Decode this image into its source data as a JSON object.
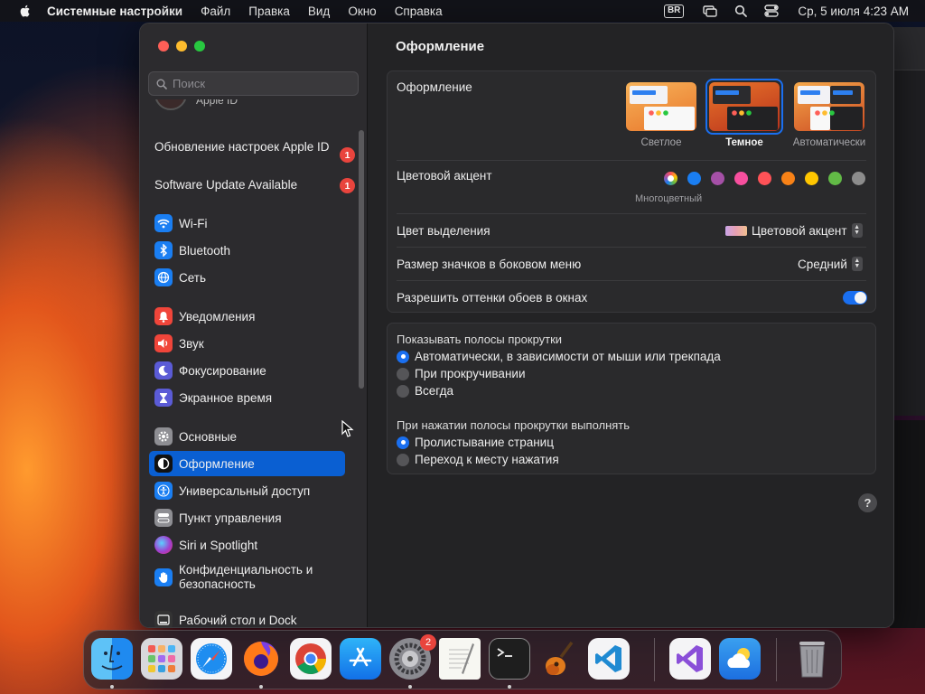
{
  "menubar": {
    "app_name": "Системные настройки",
    "items": [
      "Файл",
      "Правка",
      "Вид",
      "Окно",
      "Справка"
    ],
    "keyboard_badge": "BR",
    "clock": "Ср, 5 июля  4:23 AM"
  },
  "sidebar": {
    "search_placeholder": "Поиск",
    "apple_id_label": "Apple ID",
    "notices": [
      {
        "label": "Обновление настроек Apple ID",
        "badge": "1"
      },
      {
        "label": "Software Update Available",
        "badge": "1"
      }
    ],
    "items": [
      {
        "label": "Wi-Fi",
        "icon": "wifi-icon",
        "color": "#1a7ef2"
      },
      {
        "label": "Bluetooth",
        "icon": "bluetooth-icon",
        "color": "#1a7ef2"
      },
      {
        "label": "Сеть",
        "icon": "globe-icon",
        "color": "#1a7ef2"
      },
      {
        "label": "Уведомления",
        "icon": "bell-icon",
        "color": "#f0453a"
      },
      {
        "label": "Звук",
        "icon": "speaker-icon",
        "color": "#f0453a"
      },
      {
        "label": "Фокусирование",
        "icon": "moon-icon",
        "color": "#5b5bd6"
      },
      {
        "label": "Экранное время",
        "icon": "hourglass-icon",
        "color": "#5b5bd6"
      },
      {
        "label": "Основные",
        "icon": "gear-icon",
        "color": "#8e8e93"
      },
      {
        "label": "Оформление",
        "icon": "appearance-icon",
        "color": "#111111"
      },
      {
        "label": "Универсальный доступ",
        "icon": "accessibility-icon",
        "color": "#1a7ef2"
      },
      {
        "label": "Пункт управления",
        "icon": "control-center-icon",
        "color": "#8e8e93"
      },
      {
        "label": "Siri и Spotlight",
        "icon": "siri-icon",
        "color": "#a040d0"
      },
      {
        "label": "Конфиденциальность и безопасность",
        "icon": "hand-icon",
        "color": "#1a7ef2"
      },
      {
        "label": "Рабочий стол и Dock",
        "icon": "desktop-dock-icon",
        "color": "#333333"
      }
    ]
  },
  "content": {
    "title": "Оформление",
    "appearance": {
      "label": "Оформление",
      "options": [
        "Светлое",
        "Темное",
        "Автоматически"
      ],
      "selected": "Темное"
    },
    "accent": {
      "label": "Цветовой акцент",
      "caption": "Многоцветный",
      "colors": [
        "#1a7ef2",
        "#a550a7",
        "#f74f9e",
        "#ff5257",
        "#f88217",
        "#ffc600",
        "#62ba46",
        "#8c8c8c"
      ]
    },
    "highlight": {
      "label": "Цвет выделения",
      "value": "Цветовой акцент"
    },
    "icon_size": {
      "label": "Размер значков в боковом меню",
      "value": "Средний"
    },
    "wallpaper_tint": {
      "label": "Разрешить оттенки обоев в окнах",
      "enabled": true
    },
    "scrollbars": {
      "label": "Показывать полосы прокрутки",
      "options": [
        "Автоматически, в зависимости от мыши или трекпада",
        "При прокручивании",
        "Всегда"
      ],
      "selected_index": 0
    },
    "click_scroll": {
      "label": "При нажатии полосы прокрутки выполнять",
      "options": [
        "Пролистывание страниц",
        "Переход к месту нажатия"
      ],
      "selected_index": 0
    },
    "help": "?"
  },
  "dock": {
    "settings_badge": "2",
    "apps": [
      "finder-icon",
      "launchpad-icon",
      "safari-icon",
      "firefox-icon",
      "chrome-icon",
      "app-store-icon",
      "system-settings-icon",
      "textedit-icon",
      "terminal-icon",
      "garageband-icon",
      "vscode-icon",
      "visual-studio-icon",
      "weather-icon",
      "trash-icon"
    ]
  }
}
